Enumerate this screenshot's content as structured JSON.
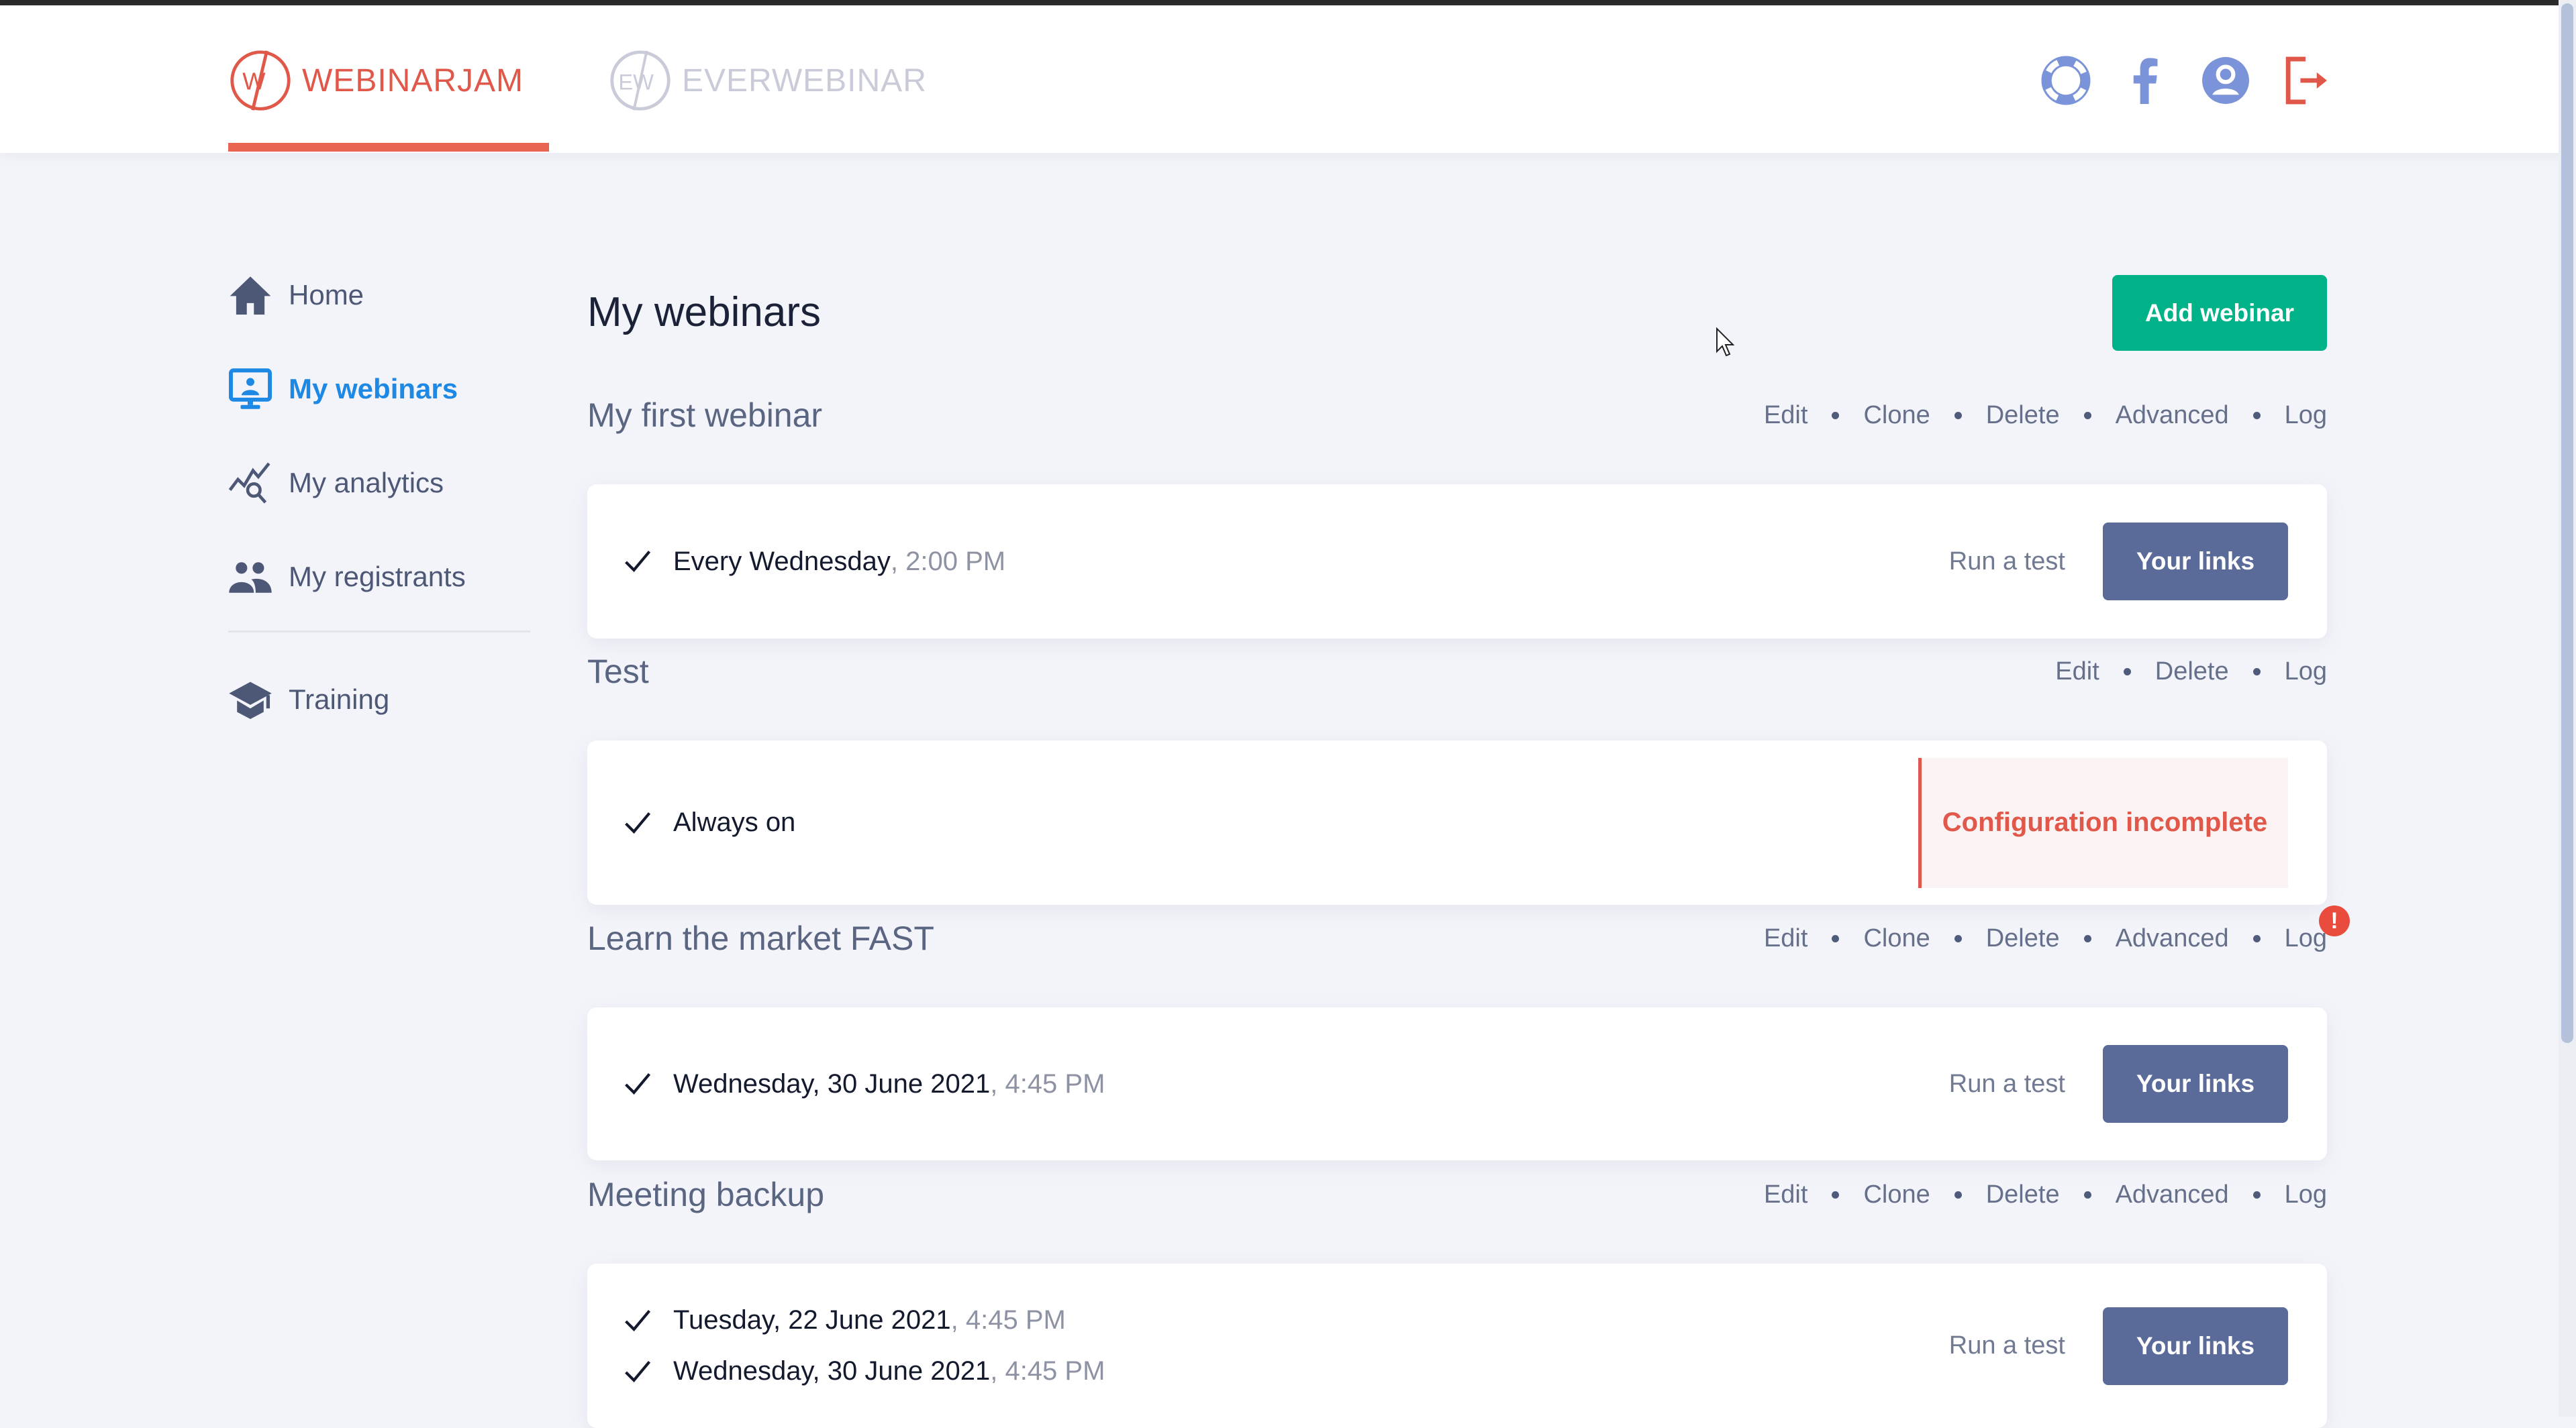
{
  "header": {
    "brands": [
      {
        "name": "WEBINARJAM",
        "mark": "WJ",
        "active": true,
        "color": "#e0584a"
      },
      {
        "name": "EVERWEBINAR",
        "mark": "EW",
        "active": false,
        "color": "#c9ccd8"
      }
    ],
    "icons": [
      {
        "name": "support-lifering-icon",
        "color": "#7b93d8"
      },
      {
        "name": "facebook-icon",
        "color": "#7b93d8"
      },
      {
        "name": "user-account-icon",
        "color": "#7b93d8"
      },
      {
        "name": "logout-icon",
        "color": "#e0584a"
      }
    ]
  },
  "sidebar": {
    "items": [
      {
        "label": "Home",
        "icon": "home-icon",
        "active": false
      },
      {
        "label": "My webinars",
        "icon": "monitor-presenter-icon",
        "active": true
      },
      {
        "label": "My analytics",
        "icon": "analytics-search-icon",
        "active": false
      },
      {
        "label": "My registrants",
        "icon": "users-icon",
        "active": false
      },
      {
        "label": "Training",
        "icon": "graduation-cap-icon",
        "active": false
      }
    ],
    "active_color": "#1e88e5"
  },
  "main": {
    "title": "My webinars",
    "add_button": "Add webinar",
    "webinars": [
      {
        "title": "My first webinar",
        "actions": [
          "Edit",
          "Clone",
          "Delete",
          "Advanced",
          "Log"
        ],
        "log_alert": false,
        "schedule": [
          {
            "date": "Every Wednesday",
            "time": ", 2:00 PM"
          }
        ],
        "run_test": "Run a test",
        "links_button": "Your links",
        "status": null
      },
      {
        "title": "Test",
        "actions": [
          "Edit",
          "Delete",
          "Log"
        ],
        "log_alert": false,
        "schedule": [
          {
            "date": "Always on",
            "time": ""
          }
        ],
        "run_test": null,
        "links_button": null,
        "status": "Configuration incomplete"
      },
      {
        "title": "Learn the market FAST",
        "actions": [
          "Edit",
          "Clone",
          "Delete",
          "Advanced",
          "Log"
        ],
        "log_alert": true,
        "log_alert_symbol": "!",
        "schedule": [
          {
            "date": "Wednesday, 30 June 2021",
            "time": ", 4:45 PM"
          }
        ],
        "run_test": "Run a test",
        "links_button": "Your links",
        "status": null
      },
      {
        "title": "Meeting backup",
        "actions": [
          "Edit",
          "Clone",
          "Delete",
          "Advanced",
          "Log"
        ],
        "log_alert": false,
        "schedule": [
          {
            "date": "Tuesday, 22 June 2021",
            "time": ", 4:45 PM"
          },
          {
            "date": "Wednesday, 30 June 2021",
            "time": ", 4:45 PM"
          }
        ],
        "run_test": "Run a test",
        "links_button": "Your links",
        "status": null
      }
    ]
  },
  "colors": {
    "accent_green": "#00b287",
    "links_button": "#5b6b99",
    "danger": "#e0584a",
    "background": "#f3f4f9"
  }
}
